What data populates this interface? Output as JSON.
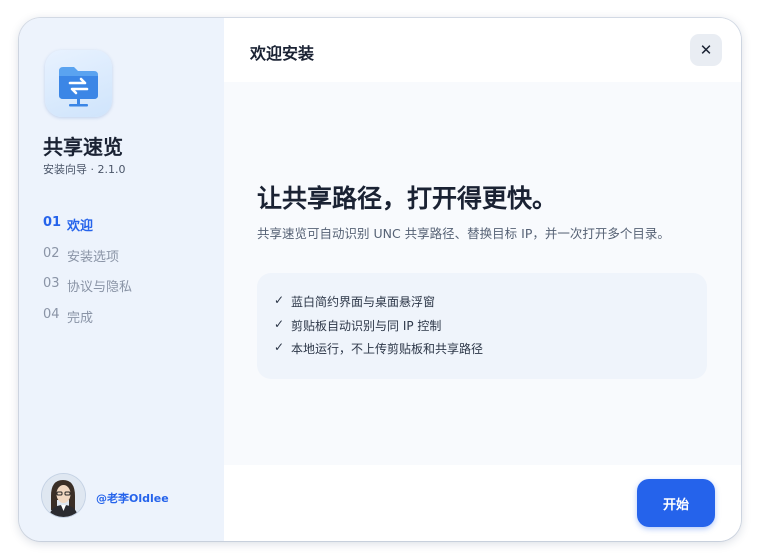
{
  "app": {
    "name": "共享速览",
    "subtitle": "安装向导 · 2.1.0",
    "icon": "shared-folder-icon"
  },
  "steps": [
    {
      "num": "01",
      "label": "欢迎",
      "active": true
    },
    {
      "num": "02",
      "label": "安装选项",
      "active": false
    },
    {
      "num": "03",
      "label": "协议与隐私",
      "active": false
    },
    {
      "num": "04",
      "label": "完成",
      "active": false
    }
  ],
  "author": {
    "handle": "@老李Oldlee"
  },
  "header": {
    "title": "欢迎安装",
    "close_label": "✕"
  },
  "content": {
    "headline": "让共享路径，打开得更快。",
    "description": "共享速览可自动识别 UNC 共享路径、替换目标 IP，并一次打开多个目录。",
    "check_mark": "✓",
    "features": [
      "蓝白简约界面与桌面悬浮窗",
      "剪贴板自动识别与同 IP 控制",
      "本地运行，不上传剪贴板和共享路径"
    ]
  },
  "footer": {
    "start_label": "开始"
  },
  "colors": {
    "accent": "#2563eb",
    "sidebar_bg": "#edf3fc",
    "main_bg": "#f8fafd",
    "text_dark": "#1a2233"
  }
}
